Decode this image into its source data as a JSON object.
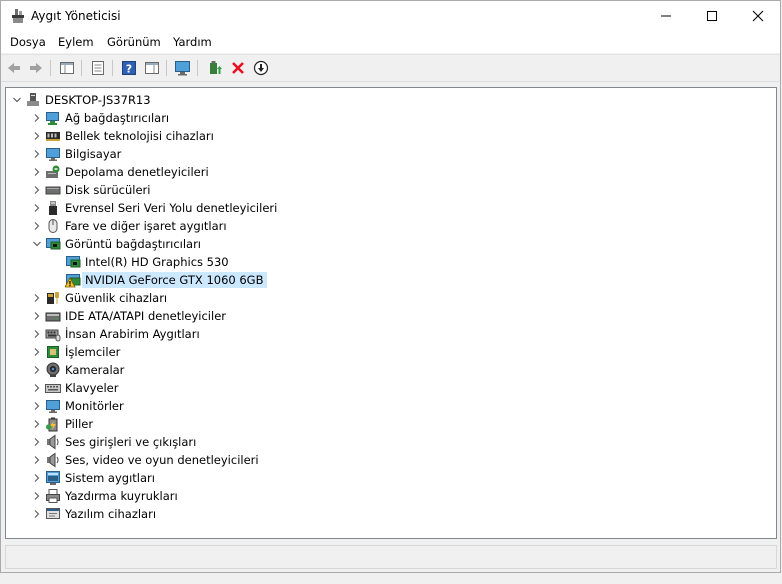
{
  "window": {
    "title": "Aygıt Yöneticisi"
  },
  "menu": [
    {
      "label": "Dosya"
    },
    {
      "label": "Eylem"
    },
    {
      "label": "Görünüm"
    },
    {
      "label": "Yardım"
    }
  ],
  "tree": {
    "root": "DESKTOP-JS37R13",
    "items": [
      {
        "label": "Ağ bağdaştırıcıları",
        "icon": "network-adapter-icon"
      },
      {
        "label": "Bellek teknolojisi cihazları",
        "icon": "memory-icon"
      },
      {
        "label": "Bilgisayar",
        "icon": "computer-icon"
      },
      {
        "label": "Depolama denetleyicileri",
        "icon": "storage-controller-icon"
      },
      {
        "label": "Disk sürücüleri",
        "icon": "disk-drive-icon"
      },
      {
        "label": "Evrensel Seri Veri Yolu denetleyicileri",
        "icon": "usb-icon"
      },
      {
        "label": "Fare ve diğer işaret aygıtları",
        "icon": "mouse-icon"
      },
      {
        "label": "Görüntü bağdaştırıcıları",
        "icon": "display-adapter-icon",
        "expanded": true,
        "children": [
          {
            "label": "Intel(R) HD Graphics 530",
            "icon": "display-adapter-icon"
          },
          {
            "label": "NVIDIA GeForce GTX 1060 6GB",
            "icon": "warning-display-adapter-icon",
            "selected": true
          }
        ]
      },
      {
        "label": "Güvenlik cihazları",
        "icon": "security-icon"
      },
      {
        "label": "IDE ATA/ATAPI denetleyiciler",
        "icon": "ide-icon"
      },
      {
        "label": "İnsan Arabirim Aygıtları",
        "icon": "hid-icon"
      },
      {
        "label": "İşlemciler",
        "icon": "processor-icon"
      },
      {
        "label": "Kameralar",
        "icon": "camera-icon"
      },
      {
        "label": "Klavyeler",
        "icon": "keyboard-icon"
      },
      {
        "label": "Monitörler",
        "icon": "monitor-icon"
      },
      {
        "label": "Piller",
        "icon": "battery-icon"
      },
      {
        "label": "Ses girişleri ve çıkışları",
        "icon": "audio-io-icon"
      },
      {
        "label": "Ses, video ve oyun denetleyicileri",
        "icon": "sound-icon"
      },
      {
        "label": "Sistem aygıtları",
        "icon": "system-devices-icon"
      },
      {
        "label": "Yazdırma kuyrukları",
        "icon": "printer-icon"
      },
      {
        "label": "Yazılım cihazları",
        "icon": "software-device-icon"
      }
    ]
  },
  "colors": {
    "selection": "#cce8ff",
    "uninstall_red": "#e81123",
    "warning_yellow": "#f6c42b"
  }
}
